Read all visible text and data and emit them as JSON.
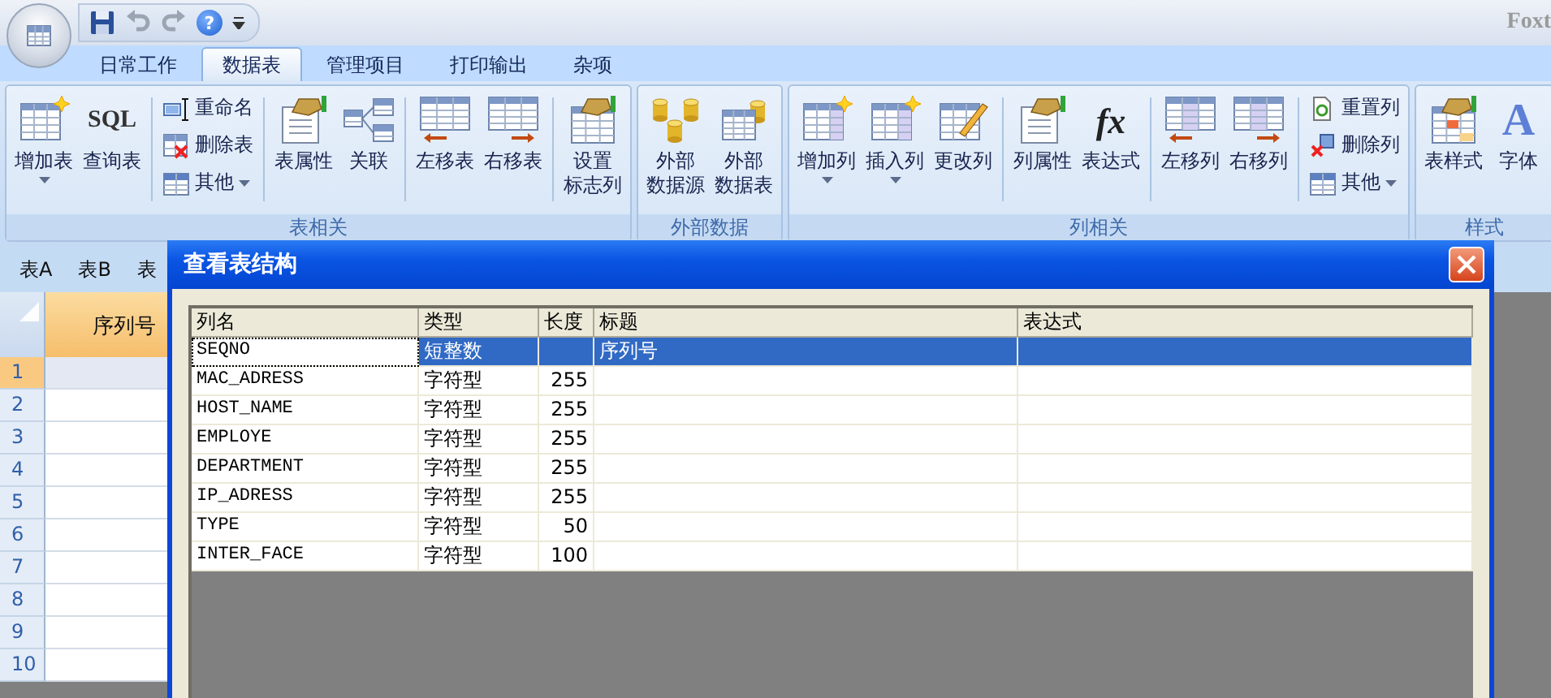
{
  "app": {
    "title": "Foxt"
  },
  "quick_access": [
    {
      "disabled": false
    },
    {
      "disabled": true
    },
    {
      "disabled": true
    },
    {
      "glyph": "?",
      "disabled": false
    }
  ],
  "tabs": [
    {
      "label": "日常工作",
      "selected": false
    },
    {
      "label": "数据表",
      "selected": true
    },
    {
      "label": "管理项目",
      "selected": false
    },
    {
      "label": "打印输出",
      "selected": false
    },
    {
      "label": "杂项",
      "selected": false
    }
  ],
  "ribbon": {
    "groups": [
      {
        "label": "表相关",
        "items": [
          {
            "kind": "large",
            "lines": [
              "增加表"
            ],
            "dropdown": true
          },
          {
            "kind": "large",
            "icon_text": "SQL",
            "lines": [
              "查询表"
            ]
          },
          {
            "kind": "separator"
          },
          {
            "kind": "stack",
            "items": [
              {
                "label": "重命名"
              },
              {
                "label": "删除表"
              },
              {
                "label": "其他",
                "dropdown": true
              }
            ]
          },
          {
            "kind": "separator"
          },
          {
            "kind": "large",
            "lines": [
              "表属性"
            ]
          },
          {
            "kind": "large",
            "lines": [
              "关联"
            ]
          },
          {
            "kind": "separator"
          },
          {
            "kind": "large",
            "lines": [
              "左移表"
            ]
          },
          {
            "kind": "large",
            "lines": [
              "右移表"
            ]
          },
          {
            "kind": "separator"
          },
          {
            "kind": "large",
            "lines": [
              "设置",
              "标志列"
            ]
          }
        ]
      },
      {
        "label": "外部数据",
        "items": [
          {
            "kind": "large",
            "lines": [
              "外部",
              "数据源"
            ]
          },
          {
            "kind": "large",
            "lines": [
              "外部",
              "数据表"
            ]
          }
        ]
      },
      {
        "label": "列相关",
        "items": [
          {
            "kind": "large",
            "lines": [
              "增加列"
            ],
            "dropdown": true
          },
          {
            "kind": "large",
            "lines": [
              "插入列"
            ],
            "dropdown": true
          },
          {
            "kind": "large",
            "lines": [
              "更改列"
            ]
          },
          {
            "kind": "separator"
          },
          {
            "kind": "large",
            "lines": [
              "列属性"
            ]
          },
          {
            "kind": "large",
            "icon_text": "fx",
            "lines": [
              "表达式"
            ]
          },
          {
            "kind": "separator"
          },
          {
            "kind": "large",
            "lines": [
              "左移列"
            ]
          },
          {
            "kind": "large",
            "lines": [
              "右移列"
            ]
          },
          {
            "kind": "separator"
          },
          {
            "kind": "stack",
            "items": [
              {
                "label": "重置列"
              },
              {
                "label": "删除列"
              },
              {
                "label": "其他",
                "dropdown": true
              }
            ]
          }
        ]
      },
      {
        "label": "样式",
        "items": [
          {
            "kind": "large",
            "lines": [
              "表样式"
            ]
          },
          {
            "kind": "large",
            "icon_text": "A",
            "lines": [
              "字体"
            ]
          }
        ]
      }
    ]
  },
  "sheet_tabs": [
    {
      "label": "表A"
    },
    {
      "label": "表B"
    },
    {
      "label": "表"
    }
  ],
  "sheet": {
    "column": "序列号",
    "rows": [
      {
        "number": "1",
        "selected": true
      },
      {
        "number": "2",
        "selected": false
      },
      {
        "number": "3",
        "selected": false
      },
      {
        "number": "4",
        "selected": false
      },
      {
        "number": "5",
        "selected": false
      },
      {
        "number": "6",
        "selected": false
      },
      {
        "number": "7",
        "selected": false
      },
      {
        "number": "8",
        "selected": false
      },
      {
        "number": "9",
        "selected": false
      },
      {
        "number": "10",
        "selected": false
      }
    ]
  },
  "dialog": {
    "title": "查看表结构",
    "columns": [
      "列名",
      "类型",
      "长度",
      "标题",
      "表达式"
    ],
    "rows": [
      {
        "name": "SEQNO",
        "type": "短整数",
        "title": "序列号",
        "selected": true
      },
      {
        "name": "MAC_ADRESS",
        "type": "字符型",
        "length": "255",
        "selected": false
      },
      {
        "name": "HOST_NAME",
        "type": "字符型",
        "length": "255",
        "selected": false
      },
      {
        "name": "EMPLOYE",
        "type": "字符型",
        "length": "255",
        "selected": false
      },
      {
        "name": "DEPARTMENT",
        "type": "字符型",
        "length": "255",
        "selected": false
      },
      {
        "name": "IP_ADRESS",
        "type": "字符型",
        "length": "255",
        "selected": false
      },
      {
        "name": "TYPE",
        "type": "字符型",
        "length": "50",
        "selected": false
      },
      {
        "name": "INTER_FACE",
        "type": "字符型",
        "length": "100",
        "selected": false
      }
    ]
  }
}
